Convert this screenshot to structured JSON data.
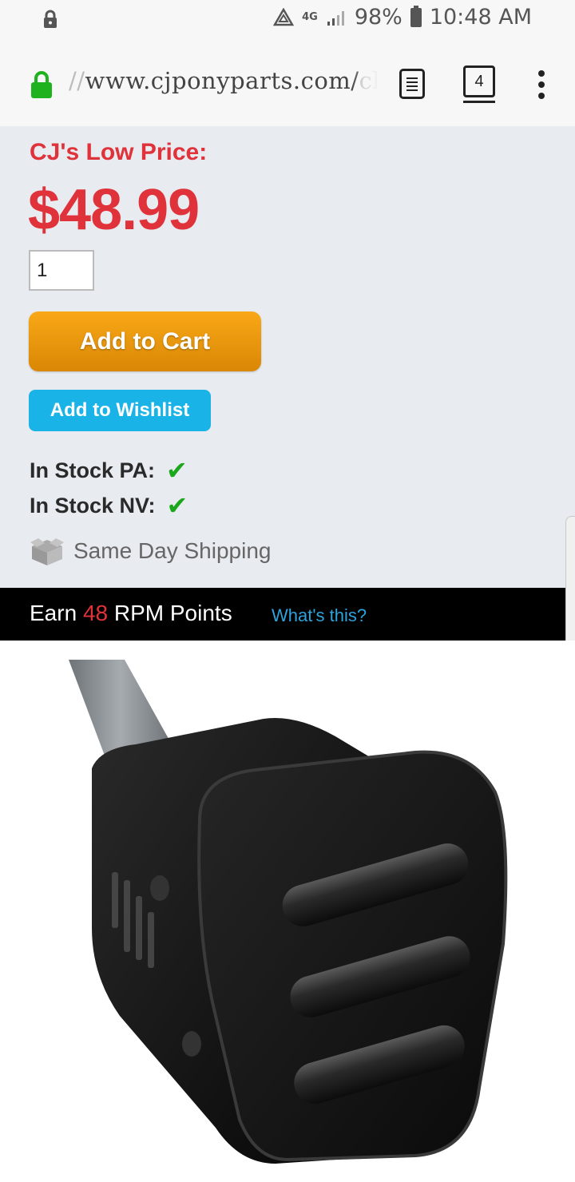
{
  "status_bar": {
    "network": "4G",
    "battery": "98%",
    "time": "10:48 AM"
  },
  "browser": {
    "url_prefix": "//",
    "url_main": "www.cjponyparts.com/",
    "url_tail": "cl",
    "tab_count": "4"
  },
  "product": {
    "price_label": "CJ's Low Price:",
    "price": "$48.99",
    "quantity": "1",
    "add_to_cart_label": "Add to Cart",
    "add_to_wishlist_label": "Add to Wishlist",
    "stock": [
      {
        "label": "In Stock PA:",
        "check": "✔"
      },
      {
        "label": "In Stock NV:",
        "check": "✔"
      }
    ],
    "shipping_label": "Same Day Shipping"
  },
  "rpm": {
    "prefix": "Earn",
    "points": "48",
    "suffix": "RPM Points",
    "link": "What's this?"
  },
  "colors": {
    "price_red": "#e0323a",
    "cart_orange": "#f9a817",
    "wishlist_blue": "#1ab3e8",
    "check_green": "#1aa71a",
    "link_blue": "#2ea3dd"
  },
  "icons": {
    "status_lock": "lock-icon",
    "url_lock": "secure-lock-icon",
    "reader": "reader-mode-icon",
    "tabs": "tab-switcher-icon",
    "menu": "more-vert-icon",
    "shipping": "shipping-box-icon",
    "check": "checkmark-icon"
  }
}
